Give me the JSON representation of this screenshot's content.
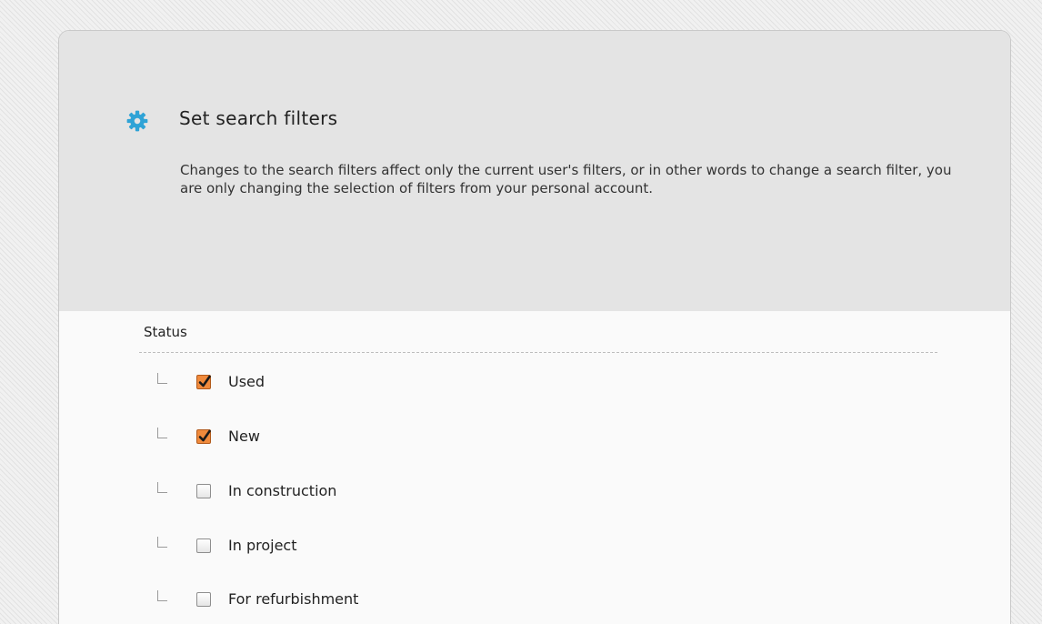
{
  "dialog": {
    "title": "Set search filters",
    "icon": "gear-icon",
    "accent_color": "#2fa3d6",
    "description": "Changes to the search filters affect only the current user's filters, or in other words to change a search filter, you are only changing the selection of filters from your personal account."
  },
  "status_section": {
    "label": "Status",
    "checked_color": "#f08a3c",
    "filters": [
      {
        "label": "Used",
        "checked": true
      },
      {
        "label": "New",
        "checked": true
      },
      {
        "label": "In construction",
        "checked": false
      },
      {
        "label": "In project",
        "checked": false
      },
      {
        "label": "For refurbishment",
        "checked": false
      }
    ]
  }
}
